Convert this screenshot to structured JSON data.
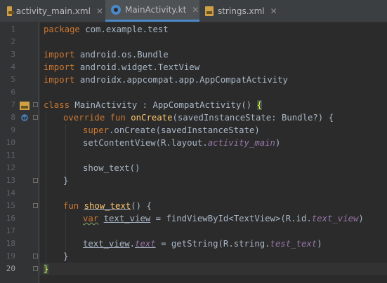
{
  "tabs": [
    {
      "label": "activity_main.xml",
      "icon": "xml-file-icon",
      "active": false
    },
    {
      "label": "MainActivity.kt",
      "icon": "kotlin-file-icon",
      "active": true
    },
    {
      "label": "strings.xml",
      "icon": "xml-file-icon",
      "active": false
    }
  ],
  "editor": {
    "line_numbers": [
      "1",
      "2",
      "3",
      "4",
      "5",
      "6",
      "7",
      "8",
      "9",
      "10",
      "11",
      "12",
      "13",
      "14",
      "15",
      "16",
      "17",
      "18",
      "19",
      "20"
    ],
    "current_line": "20",
    "lines": {
      "l1_kw": "package",
      "l1_rest": " com.example.test",
      "l3_kw": "import",
      "l3_rest": " android.os.Bundle",
      "l4_kw": "import",
      "l4_rest": " android.widget.TextView",
      "l5_kw": "import",
      "l5_rest": " androidx.appcompat.app.AppCompatActivity",
      "l7_kw": "class",
      "l7_rest": " MainActivity : AppCompatActivity() ",
      "l7_brace": "{",
      "l8_kw": "override fun",
      "l8_fn": "onCreate",
      "l8_rest": "(savedInstanceState: Bundle?) {",
      "l9_kw": "super",
      "l9_rest": ".onCreate(savedInstanceState)",
      "l10_pre": "setContentView(R.layout.",
      "l10_it": "activity_main",
      "l10_post": ")",
      "l12": "show_text()",
      "l13": "}",
      "l15_kw": "fun",
      "l15_fn": "show_text",
      "l15_rest": "() {",
      "l16_kw": "var",
      "l16_var": "text_view",
      "l16_pre": " = findViewById<TextView>(R.id.",
      "l16_it": "text_view",
      "l16_post": ")",
      "l18_var": "text_view",
      "l18_dot": ".",
      "l18_prop": "text",
      "l18_pre": " = getString(R.string.",
      "l18_it": "test_text",
      "l18_post": ")",
      "l19": "}",
      "l20": "}"
    }
  },
  "colors": {
    "background": "#2b2b2b",
    "keyword": "#cc7832",
    "function": "#ffc66d",
    "property": "#9876aa",
    "text": "#a9b7c6",
    "tab_underline": "#4a88c7"
  }
}
